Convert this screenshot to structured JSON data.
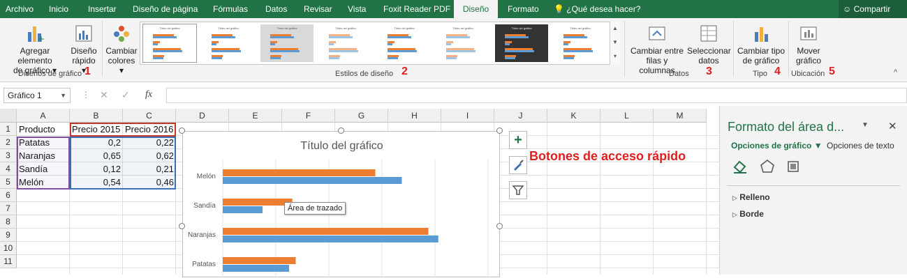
{
  "tabs": [
    "Archivo",
    "Inicio",
    "Insertar",
    "Diseño de página",
    "Fórmulas",
    "Datos",
    "Revisar",
    "Vista",
    "Foxit Reader PDF",
    "Diseño",
    "Formato"
  ],
  "tell_me": "¿Qué desea hacer?",
  "share": "Compartir",
  "ribbon": {
    "add_element": [
      "Agregar elemento",
      "de gráfico"
    ],
    "quick_layout": [
      "Diseño",
      "rápido"
    ],
    "change_colors": [
      "Cambiar",
      "colores"
    ],
    "group_designs": "Diseños de gráfico",
    "group_styles": "Estilos de diseño",
    "switch_rows": [
      "Cambiar entre",
      "filas y columnas"
    ],
    "select_data": [
      "Seleccionar",
      "datos"
    ],
    "group_data": "Datos",
    "change_type": [
      "Cambiar tipo",
      "de gráfico"
    ],
    "group_type": "Tipo",
    "move_chart": [
      "Mover",
      "gráfico"
    ],
    "group_location": "Ubicación",
    "num1": "1",
    "num2": "2",
    "num3": "3",
    "num4": "4",
    "num5": "5",
    "thumb_title": "Título del gráfico"
  },
  "formula_bar": {
    "name_box": "Gráfico 1",
    "fx": "fx"
  },
  "columns": [
    "A",
    "B",
    "C",
    "D",
    "E",
    "F",
    "G",
    "H",
    "I",
    "J",
    "K",
    "L",
    "M"
  ],
  "rows": [
    "1",
    "2",
    "3",
    "4",
    "5",
    "6",
    "7",
    "8",
    "9",
    "10",
    "11"
  ],
  "cells": {
    "header": [
      "Producto",
      "Precio 2015",
      "Precio 2016"
    ],
    "data": [
      [
        "Patatas",
        "0,2",
        "0,22"
      ],
      [
        "Naranjas",
        "0,65",
        "0,62"
      ],
      [
        "Sandía",
        "0,12",
        "0,21"
      ],
      [
        "Melón",
        "0,54",
        "0,46"
      ]
    ]
  },
  "chart": {
    "title": "Título del gráfico",
    "tooltip": "Área de trazado",
    "quick_label": "Botones de acceso rápido"
  },
  "chart_data": {
    "type": "bar",
    "title": "Título del gráfico",
    "categories": [
      "Melón",
      "Sandía",
      "Naranjas",
      "Patatas"
    ],
    "series": [
      {
        "name": "Precio 2015",
        "values": [
          0.54,
          0.12,
          0.65,
          0.2
        ],
        "color": "#5b9bd5"
      },
      {
        "name": "Precio 2016",
        "values": [
          0.46,
          0.21,
          0.62,
          0.22
        ],
        "color": "#ed7d31"
      }
    ],
    "xlim": [
      0,
      0.8
    ]
  },
  "pane": {
    "title": "Formato del área d...",
    "tab_chart_options": "Opciones de gráfico",
    "tab_text_options": "Opciones de texto",
    "fill": "Relleno",
    "border": "Borde"
  },
  "colors": {
    "excel_green": "#217346",
    "accent_red": "#e02020"
  }
}
